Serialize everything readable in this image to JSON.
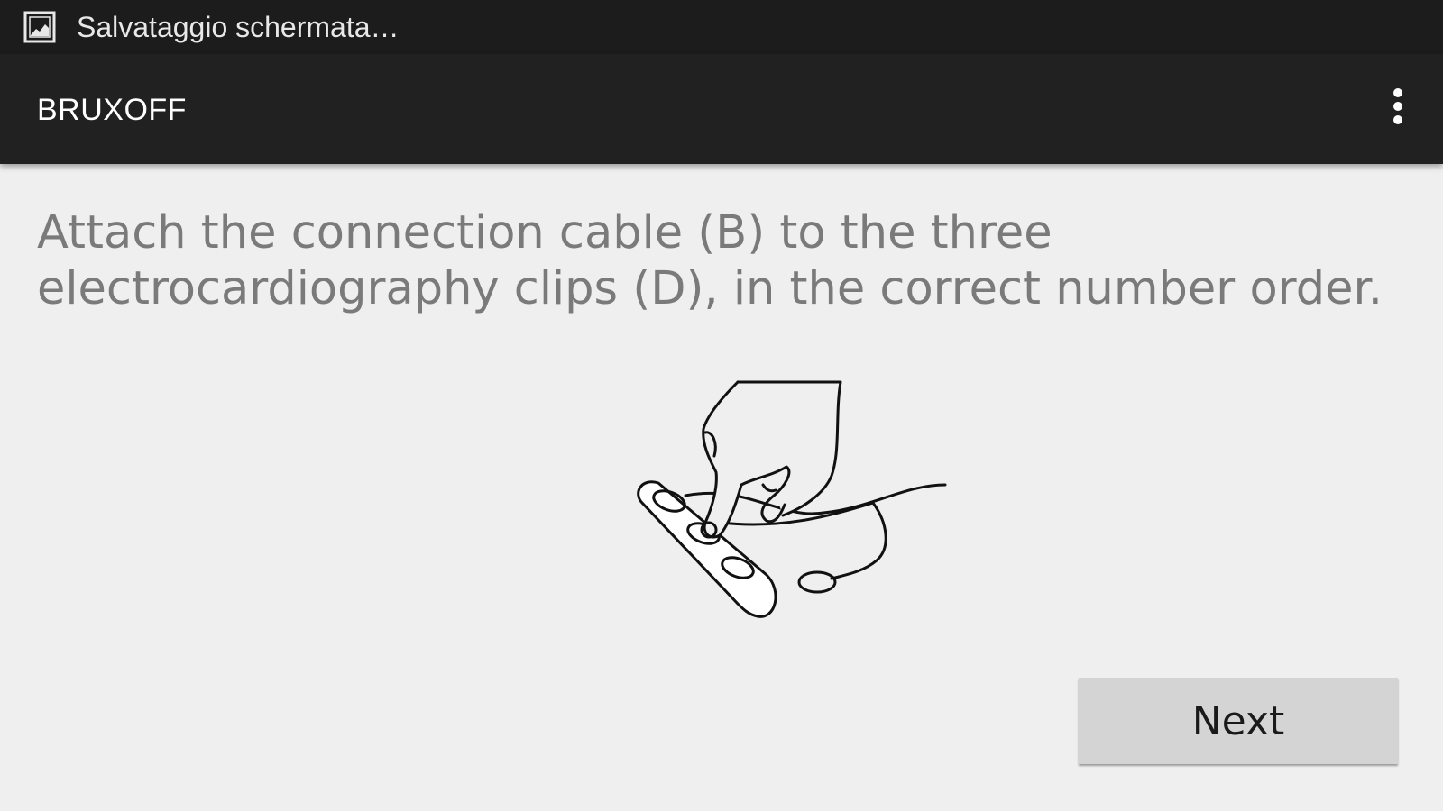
{
  "status_bar": {
    "notification_icon": "screenshot-icon",
    "notification_text": "Salvataggio schermata…"
  },
  "action_bar": {
    "title": "BRUXOFF",
    "overflow_icon": "more-vert-icon"
  },
  "main": {
    "instruction": "Attach the connection cable (B) to the three electrocardiography clips (D), in the correct number order.",
    "illustration": "hand-attaching-cable-to-clips-illustration",
    "next_label": "Next"
  },
  "colors": {
    "status_bar_bg": "#1c1c1c",
    "action_bar_bg": "#212121",
    "content_bg": "#efefef",
    "instruction_text": "#7a7a7a",
    "button_bg": "#d4d4d4"
  }
}
